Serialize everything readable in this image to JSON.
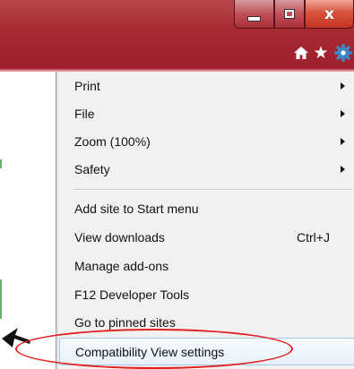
{
  "window": {
    "minimize_icon": "minimize-icon",
    "maximize_icon": "maximize-icon",
    "close_glyph": "x"
  },
  "toolbar": {
    "icons": [
      "home-icon",
      "star-icon",
      "gear-icon"
    ],
    "star_glyph": "★"
  },
  "menu": {
    "items": [
      {
        "label": "Print",
        "has_submenu": true
      },
      {
        "label": "File",
        "has_submenu": true
      },
      {
        "label": "Zoom (100%)",
        "has_submenu": true
      },
      {
        "label": "Safety",
        "has_submenu": true
      },
      {
        "label": "Add site to Start menu"
      },
      {
        "label": "View downloads",
        "shortcut": "Ctrl+J"
      },
      {
        "label": "Manage add-ons"
      },
      {
        "label": "F12 Developer Tools"
      },
      {
        "label": "Go to pinned sites"
      },
      {
        "label": "Compatibility View settings",
        "highlighted": true
      }
    ]
  },
  "colors": {
    "titlebar": "#a82a34",
    "close_button": "#d9543c",
    "menu_background": "#f1f1f1",
    "highlight_border": "#a9c7e8",
    "annotation": "#e12020"
  }
}
